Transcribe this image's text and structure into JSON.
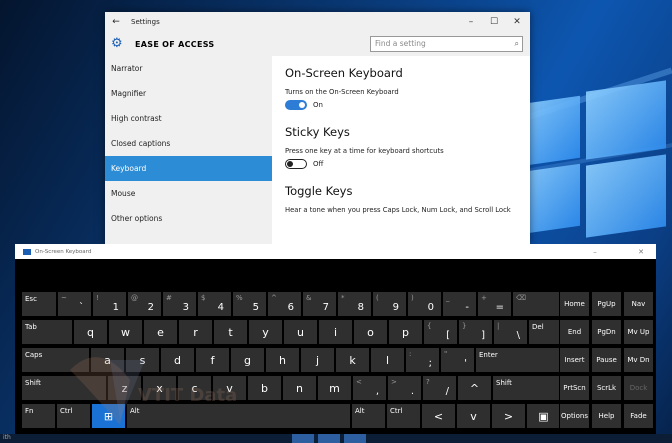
{
  "settings": {
    "title": "Settings",
    "section_title": "EASE OF ACCESS",
    "search_placeholder": "Find a setting",
    "nav": [
      {
        "label": "Narrator",
        "active": false
      },
      {
        "label": "Magnifier",
        "active": false
      },
      {
        "label": "High contrast",
        "active": false
      },
      {
        "label": "Closed captions",
        "active": false
      },
      {
        "label": "Keyboard",
        "active": true
      },
      {
        "label": "Mouse",
        "active": false
      },
      {
        "label": "Other options",
        "active": false
      }
    ],
    "content": {
      "osk_heading": "On-Screen Keyboard",
      "osk_desc": "Turns on the On-Screen Keyboard",
      "osk_state": "On",
      "sticky_heading": "Sticky Keys",
      "sticky_desc": "Press one key at a time for keyboard shortcuts",
      "sticky_state": "Off",
      "toggle_heading": "Toggle Keys",
      "toggle_desc": "Hear a tone when you press Caps Lock, Num Lock, and Scroll Lock"
    }
  },
  "osk": {
    "title": "On-Screen Keyboard",
    "rows": {
      "r1": [
        {
          "lbl": "Esc",
          "w": 36
        },
        {
          "tl": "~",
          "br": "`",
          "w": 35
        },
        {
          "tl": "!",
          "br": "1",
          "w": 35
        },
        {
          "tl": "@",
          "br": "2",
          "w": 35
        },
        {
          "tl": "#",
          "br": "3",
          "w": 35
        },
        {
          "tl": "$",
          "br": "4",
          "w": 35
        },
        {
          "tl": "%",
          "br": "5",
          "w": 35
        },
        {
          "tl": "^",
          "br": "6",
          "w": 35
        },
        {
          "tl": "&",
          "br": "7",
          "w": 35
        },
        {
          "tl": "*",
          "br": "8",
          "w": 35
        },
        {
          "tl": "(",
          "br": "9",
          "w": 35
        },
        {
          "tl": ")",
          "br": "0",
          "w": 35
        },
        {
          "tl": "_",
          "br": "-",
          "w": 35
        },
        {
          "tl": "+",
          "br": "=",
          "w": 35
        },
        {
          "tl": "⌫",
          "w": 54
        }
      ],
      "r2": [
        {
          "lbl": "Tab",
          "w": 52
        },
        {
          "c": "q",
          "w": 35
        },
        {
          "c": "w",
          "w": 35
        },
        {
          "c": "e",
          "w": 35
        },
        {
          "c": "r",
          "w": 35
        },
        {
          "c": "t",
          "w": 35
        },
        {
          "c": "y",
          "w": 35
        },
        {
          "c": "u",
          "w": 35
        },
        {
          "c": "i",
          "w": 35
        },
        {
          "c": "o",
          "w": 35
        },
        {
          "c": "p",
          "w": 35
        },
        {
          "tl": "{",
          "br": "[",
          "w": 35
        },
        {
          "tl": "}",
          "br": "]",
          "w": 35
        },
        {
          "tl": "|",
          "br": "\\",
          "w": 35
        },
        {
          "lbl": "Del",
          "w": 38
        }
      ],
      "r3": [
        {
          "lbl": "Caps",
          "w": 69
        },
        {
          "c": "a",
          "w": 35
        },
        {
          "c": "s",
          "w": 35
        },
        {
          "c": "d",
          "w": 35
        },
        {
          "c": "f",
          "w": 35
        },
        {
          "c": "g",
          "w": 35
        },
        {
          "c": "h",
          "w": 35
        },
        {
          "c": "j",
          "w": 35
        },
        {
          "c": "k",
          "w": 35
        },
        {
          "c": "l",
          "w": 35
        },
        {
          "tl": ":",
          "br": ";",
          "w": 35
        },
        {
          "tl": "\"",
          "br": "'",
          "w": 35
        },
        {
          "lbl": "Enter",
          "w": 88
        }
      ],
      "r4": [
        {
          "lbl": "Shift",
          "w": 86
        },
        {
          "c": "z",
          "w": 35
        },
        {
          "c": "x",
          "w": 35
        },
        {
          "c": "c",
          "w": 35
        },
        {
          "c": "v",
          "w": 35
        },
        {
          "c": "b",
          "w": 35
        },
        {
          "c": "n",
          "w": 35
        },
        {
          "c": "m",
          "w": 35
        },
        {
          "tl": "<",
          "br": ",",
          "w": 35
        },
        {
          "tl": ">",
          "br": ".",
          "w": 35
        },
        {
          "tl": "?",
          "br": "/",
          "w": 35
        },
        {
          "c": "^",
          "w": 35
        },
        {
          "lbl": "Shift",
          "w": 71
        }
      ],
      "r5": [
        {
          "lbl": "Fn",
          "w": 35
        },
        {
          "lbl": "Ctrl",
          "w": 35
        },
        {
          "c": "⊞",
          "w": 35,
          "win": true
        },
        {
          "lbl": "Alt",
          "w": 225
        },
        {
          "lbl": "Alt",
          "w": 35
        },
        {
          "lbl": "Ctrl",
          "w": 35
        },
        {
          "c": "<",
          "w": 35
        },
        {
          "c": "v",
          "w": 35
        },
        {
          "c": ">",
          "w": 35
        },
        {
          "c": "▣",
          "w": 35
        }
      ]
    },
    "nav": [
      [
        "Home",
        "PgUp",
        "Nav"
      ],
      [
        "End",
        "PgDn",
        "Mv Up"
      ],
      [
        "Insert",
        "Pause",
        "Mv Dn"
      ],
      [
        "PrtScn",
        "ScrLk",
        "Dock"
      ],
      [
        "Options",
        "Help",
        "Fade"
      ]
    ]
  },
  "watermark": "VTIT Data",
  "taskbar_left": "ith"
}
